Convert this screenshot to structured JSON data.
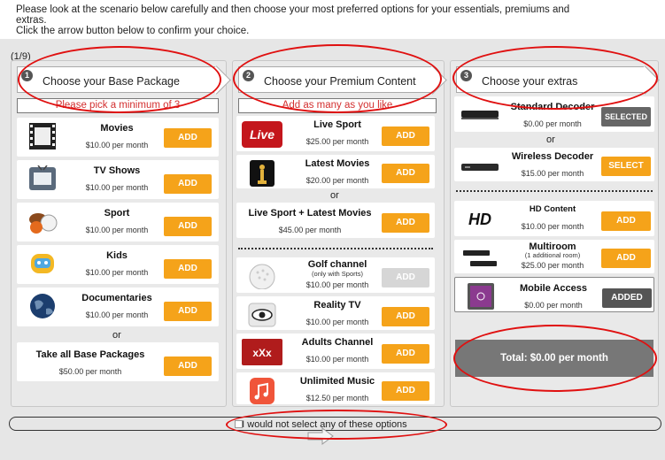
{
  "instructions": {
    "line1": "Please look at the scenario below carefully and then choose your most preferred options for your essentials, premiums and",
    "line2": "extras.",
    "line3": "Click the arrow button below to confirm your choice."
  },
  "progress": "(1/9)",
  "col1": {
    "step": "1",
    "header": "Choose your Base Package",
    "hint": "Please pick a minimum of 3",
    "items": [
      {
        "name": "Movies",
        "price": "$10.00 per month",
        "button": "ADD",
        "icon": "film-icon"
      },
      {
        "name": "TV Shows",
        "price": "$10.00 per month",
        "button": "ADD",
        "icon": "tv-icon"
      },
      {
        "name": "Sport",
        "price": "$10.00 per month",
        "button": "ADD",
        "icon": "balls-icon"
      },
      {
        "name": "Kids",
        "price": "$10.00 per month",
        "button": "ADD",
        "icon": "robot-icon"
      },
      {
        "name": "Documentaries",
        "price": "$10.00 per month",
        "button": "ADD",
        "icon": "globe-icon"
      }
    ],
    "or": "or",
    "all": {
      "name": "Take all Base Packages",
      "price": "$50.00 per month",
      "button": "ADD"
    }
  },
  "col2": {
    "step": "2",
    "header": "Choose your Premium Content",
    "hint": "Add as many as you like",
    "items": [
      {
        "name": "Live Sport",
        "price": "$25.00 per month",
        "button": "ADD",
        "icon": "live-icon",
        "icon_text": "Live"
      },
      {
        "name": "Latest Movies",
        "price": "$20.00 per month",
        "button": "ADD",
        "icon": "oscar-icon"
      }
    ],
    "or": "or",
    "combo": {
      "name": "Live Sport + Latest Movies",
      "price": "$45.00 per month",
      "button": "ADD"
    },
    "items2": [
      {
        "name": "Golf channel",
        "sub": "(only with Sports)",
        "price": "$10.00 per month",
        "button": "ADD",
        "disabled": true,
        "icon": "golf-ball-icon"
      },
      {
        "name": "Reality TV",
        "price": "$10.00 per month",
        "button": "ADD",
        "icon": "eye-icon"
      },
      {
        "name": "Adults Channel",
        "price": "$10.00 per month",
        "button": "ADD",
        "icon": "xxx-folder-icon",
        "icon_text": "xXx"
      },
      {
        "name": "Unlimited Music",
        "price": "$12.50 per month",
        "button": "ADD",
        "icon": "music-icon"
      }
    ]
  },
  "col3": {
    "step": "3",
    "header": "Choose your extras",
    "standard": {
      "name": "Standard Decoder",
      "price": "$0.00 per month",
      "button": "SELECTED"
    },
    "or": "or",
    "wireless": {
      "name": "Wireless Decoder",
      "price": "$15.00 per month",
      "button": "SELECT"
    },
    "hd": {
      "name": "HD Content",
      "price": "$10.00 per month",
      "button": "ADD",
      "icon_text": "HD"
    },
    "multiroom": {
      "name": "Multiroom",
      "sub": "(1 additional room)",
      "price": "$25.00 per month",
      "button": "ADD"
    },
    "mobile": {
      "name": "Mobile Access",
      "price": "$0.00 per month",
      "button": "ADDED"
    }
  },
  "total": "Total: $0.00 per month",
  "none_option": "I would not select any of these options",
  "colors": {
    "add": "#f5a31a",
    "hint_text": "#d32f2f",
    "annotation": "#e01010"
  }
}
